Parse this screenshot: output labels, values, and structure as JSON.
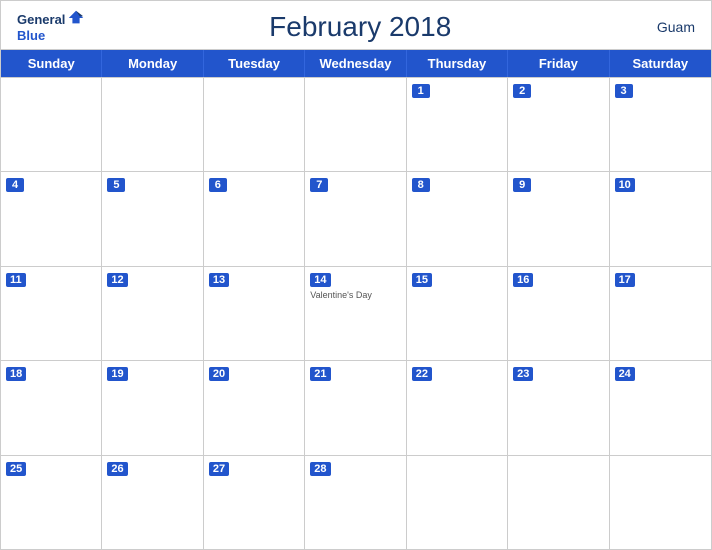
{
  "header": {
    "logo_general": "General",
    "logo_blue": "Blue",
    "title": "February 2018",
    "region": "Guam"
  },
  "dayHeaders": [
    "Sunday",
    "Monday",
    "Tuesday",
    "Wednesday",
    "Thursday",
    "Friday",
    "Saturday"
  ],
  "weeks": [
    [
      {
        "day": "",
        "empty": true
      },
      {
        "day": "",
        "empty": true
      },
      {
        "day": "",
        "empty": true
      },
      {
        "day": "",
        "empty": true
      },
      {
        "day": "1"
      },
      {
        "day": "2"
      },
      {
        "day": "3"
      }
    ],
    [
      {
        "day": "4"
      },
      {
        "day": "5"
      },
      {
        "day": "6"
      },
      {
        "day": "7"
      },
      {
        "day": "8"
      },
      {
        "day": "9"
      },
      {
        "day": "10"
      }
    ],
    [
      {
        "day": "11"
      },
      {
        "day": "12"
      },
      {
        "day": "13"
      },
      {
        "day": "14",
        "event": "Valentine's Day"
      },
      {
        "day": "15"
      },
      {
        "day": "16"
      },
      {
        "day": "17"
      }
    ],
    [
      {
        "day": "18"
      },
      {
        "day": "19"
      },
      {
        "day": "20"
      },
      {
        "day": "21"
      },
      {
        "day": "22"
      },
      {
        "day": "23"
      },
      {
        "day": "24"
      }
    ],
    [
      {
        "day": "25"
      },
      {
        "day": "26"
      },
      {
        "day": "27"
      },
      {
        "day": "28"
      },
      {
        "day": "",
        "empty": true
      },
      {
        "day": "",
        "empty": true
      },
      {
        "day": "",
        "empty": true
      }
    ]
  ]
}
